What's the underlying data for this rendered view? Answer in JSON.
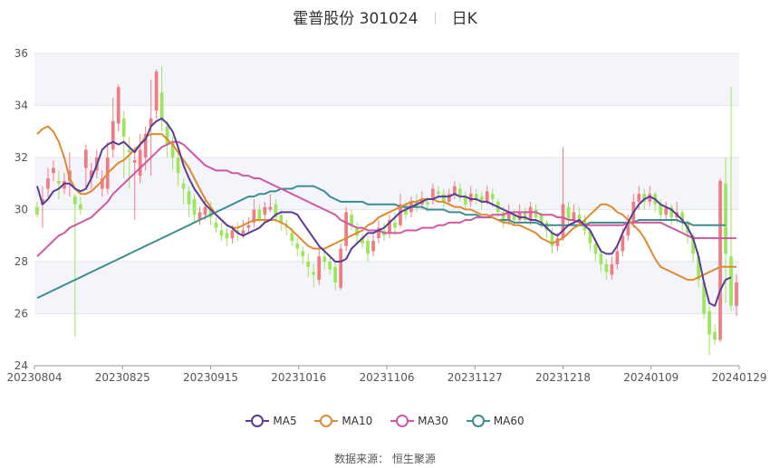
{
  "header": {
    "title": "霍普股份 301024",
    "period": "日K"
  },
  "source": {
    "label": "数据来源：",
    "name": "恒生聚源"
  },
  "colors": {
    "up": "#f07c82",
    "down": "#9be65a",
    "MA5": "#5a3b9a",
    "MA10": "#e08a30",
    "MA30": "#d257a2",
    "MA60": "#3a8e92"
  },
  "chart_data": {
    "type": "candlestick",
    "ylim": [
      24,
      36
    ],
    "yticks": [
      "24",
      "26",
      "28",
      "30",
      "32",
      "34",
      "36"
    ],
    "xticks": [
      "20230804",
      "20230825",
      "20230915",
      "20231016",
      "20231106",
      "20231127",
      "20231218",
      "20240109",
      "20240129"
    ],
    "grid": true,
    "legend_position": "bottom",
    "legend": [
      "MA5",
      "MA10",
      "MA30",
      "MA60"
    ],
    "candles": [
      [
        30.1,
        29.8,
        30.3,
        29.7
      ],
      [
        30.2,
        30.4,
        30.9,
        29.3
      ],
      [
        30.8,
        31.2,
        31.6,
        30.5
      ],
      [
        31.4,
        31.6,
        31.9,
        31.1
      ],
      [
        31.1,
        31.0,
        31.5,
        30.4
      ],
      [
        30.8,
        31.1,
        31.4,
        30.6
      ],
      [
        31.1,
        31.5,
        32.2,
        30.5
      ],
      [
        30.5,
        30.2,
        30.6,
        25.1
      ],
      [
        30.2,
        30.0,
        30.5,
        29.8
      ],
      [
        31.6,
        32.3,
        32.5,
        30.8
      ],
      [
        31.2,
        31.5,
        31.8,
        30.8
      ],
      [
        31.5,
        32.0,
        32.3,
        31.2
      ],
      [
        30.8,
        31.2,
        31.5,
        30.5
      ],
      [
        30.8,
        32.0,
        32.6,
        30.6
      ],
      [
        32.3,
        33.4,
        34.3,
        32.0
      ],
      [
        33.3,
        34.7,
        34.8,
        33.0
      ],
      [
        33.5,
        32.8,
        33.8,
        31.2
      ],
      [
        32.3,
        32.2,
        32.8,
        30.8
      ],
      [
        31.8,
        31.9,
        32.4,
        29.6
      ],
      [
        31.3,
        32.3,
        32.9,
        31.0
      ],
      [
        32.0,
        32.9,
        33.2,
        31.5
      ],
      [
        33.2,
        33.5,
        35.0,
        31.3
      ],
      [
        33.8,
        35.3,
        35.4,
        33.5
      ],
      [
        34.5,
        33.5,
        35.5,
        33.0
      ],
      [
        33.2,
        32.5,
        33.4,
        32.0
      ],
      [
        32.6,
        32.0,
        32.8,
        31.5
      ],
      [
        32.0,
        31.4,
        32.2,
        30.9
      ],
      [
        31.0,
        30.8,
        31.2,
        30.2
      ],
      [
        30.7,
        30.2,
        30.9,
        29.7
      ],
      [
        30.4,
        29.8,
        30.6,
        29.5
      ],
      [
        29.6,
        29.9,
        30.1,
        29.4
      ],
      [
        29.8,
        30.1,
        30.5,
        29.6
      ],
      [
        30.1,
        29.7,
        30.3,
        29.4
      ],
      [
        29.5,
        29.3,
        29.7,
        29.1
      ],
      [
        29.2,
        29.0,
        29.5,
        28.8
      ],
      [
        29.1,
        28.9,
        29.3,
        28.6
      ],
      [
        28.9,
        29.2,
        29.4,
        28.7
      ],
      [
        29.2,
        29.1,
        29.5,
        28.8
      ],
      [
        29.0,
        29.2,
        29.6,
        28.9
      ],
      [
        29.3,
        29.4,
        29.7,
        29.1
      ],
      [
        29.5,
        30.0,
        30.4,
        29.3
      ],
      [
        30.0,
        29.6,
        30.2,
        29.5
      ],
      [
        29.8,
        30.1,
        30.3,
        29.5
      ],
      [
        30.0,
        30.1,
        30.6,
        29.9
      ],
      [
        30.2,
        29.7,
        30.4,
        29.5
      ],
      [
        29.8,
        29.5,
        30.0,
        29.2
      ],
      [
        29.4,
        29.3,
        29.6,
        29.0
      ],
      [
        29.1,
        28.8,
        29.3,
        28.6
      ],
      [
        28.7,
        28.5,
        28.9,
        28.2
      ],
      [
        28.4,
        28.2,
        28.6,
        27.9
      ],
      [
        28.0,
        27.8,
        28.3,
        27.4
      ],
      [
        27.6,
        27.5,
        27.9,
        27.0
      ],
      [
        27.3,
        28.2,
        28.6,
        27.1
      ],
      [
        28.2,
        28.0,
        28.5,
        27.7
      ],
      [
        28.0,
        27.7,
        28.3,
        27.5
      ],
      [
        27.8,
        27.2,
        28.0,
        26.9
      ],
      [
        27.0,
        28.5,
        28.7,
        26.9
      ],
      [
        28.6,
        29.9,
        30.1,
        28.4
      ],
      [
        29.8,
        29.4,
        30.0,
        29.2
      ],
      [
        29.3,
        29.0,
        29.5,
        28.7
      ],
      [
        28.9,
        28.7,
        29.1,
        28.5
      ],
      [
        28.8,
        28.3,
        29.0,
        28.0
      ],
      [
        28.4,
        28.8,
        29.1,
        28.2
      ],
      [
        28.9,
        29.3,
        29.6,
        28.7
      ],
      [
        29.2,
        29.0,
        29.5,
        28.8
      ],
      [
        29.1,
        29.6,
        29.8,
        28.9
      ],
      [
        29.5,
        29.3,
        29.9,
        29.0
      ],
      [
        29.4,
        30.2,
        30.6,
        29.3
      ],
      [
        30.1,
        29.8,
        30.3,
        29.6
      ],
      [
        29.9,
        30.3,
        30.5,
        29.7
      ],
      [
        30.3,
        30.1,
        30.6,
        29.9
      ],
      [
        30.2,
        30.4,
        30.7,
        30.0
      ],
      [
        30.3,
        30.2,
        30.5,
        29.9
      ],
      [
        30.4,
        30.8,
        31.0,
        30.2
      ],
      [
        30.7,
        30.6,
        30.9,
        30.4
      ],
      [
        30.6,
        30.3,
        30.8,
        30.1
      ],
      [
        30.3,
        30.6,
        30.8,
        30.2
      ],
      [
        30.6,
        30.9,
        31.1,
        30.4
      ],
      [
        30.8,
        30.5,
        31.0,
        30.3
      ],
      [
        30.5,
        30.2,
        30.7,
        30.0
      ],
      [
        30.3,
        30.6,
        30.9,
        30.1
      ],
      [
        30.6,
        30.4,
        30.8,
        30.2
      ],
      [
        30.5,
        30.3,
        30.7,
        30.0
      ],
      [
        30.3,
        30.7,
        30.9,
        30.2
      ],
      [
        30.6,
        30.4,
        30.8,
        30.1
      ],
      [
        30.3,
        29.9,
        30.4,
        29.7
      ],
      [
        29.9,
        29.5,
        30.1,
        29.3
      ],
      [
        29.6,
        29.9,
        30.2,
        29.4
      ],
      [
        29.8,
        29.6,
        30.0,
        29.4
      ],
      [
        29.6,
        29.9,
        30.2,
        29.5
      ],
      [
        29.9,
        29.6,
        30.1,
        29.5
      ],
      [
        29.6,
        30.1,
        30.3,
        29.4
      ],
      [
        30.0,
        29.7,
        30.2,
        29.5
      ],
      [
        29.8,
        29.5,
        29.9,
        29.3
      ],
      [
        29.5,
        29.2,
        29.6,
        28.9
      ],
      [
        29.1,
        28.6,
        29.3,
        28.3
      ],
      [
        28.6,
        28.9,
        29.1,
        28.4
      ],
      [
        28.9,
        30.2,
        32.4,
        28.8
      ],
      [
        30.1,
        29.6,
        30.3,
        29.4
      ],
      [
        29.6,
        29.9,
        30.2,
        29.4
      ],
      [
        29.8,
        29.6,
        30.1,
        29.4
      ],
      [
        29.6,
        29.2,
        29.8,
        29.0
      ],
      [
        29.2,
        28.7,
        29.3,
        28.4
      ],
      [
        28.7,
        28.3,
        28.9,
        28.0
      ],
      [
        28.3,
        27.9,
        28.5,
        27.6
      ],
      [
        27.9,
        27.6,
        28.1,
        27.3
      ],
      [
        27.5,
        27.9,
        28.2,
        27.3
      ],
      [
        27.9,
        28.4,
        28.7,
        27.7
      ],
      [
        28.4,
        29.0,
        29.3,
        28.2
      ],
      [
        29.0,
        29.5,
        29.8,
        28.8
      ],
      [
        29.5,
        30.3,
        30.6,
        29.3
      ],
      [
        30.3,
        30.6,
        30.9,
        30.0
      ],
      [
        30.6,
        30.3,
        30.8,
        30.0
      ],
      [
        30.3,
        30.6,
        30.9,
        30.1
      ],
      [
        30.6,
        30.2,
        30.7,
        29.9
      ],
      [
        30.2,
        29.8,
        30.4,
        29.5
      ],
      [
        29.8,
        30.1,
        30.3,
        29.6
      ],
      [
        30.1,
        29.7,
        30.2,
        29.4
      ],
      [
        29.7,
        29.9,
        30.3,
        29.5
      ],
      [
        29.9,
        29.5,
        30.0,
        29.2
      ],
      [
        29.5,
        29.1,
        29.6,
        28.7
      ],
      [
        29.0,
        28.3,
        29.1,
        28.0
      ],
      [
        28.2,
        27.3,
        28.4,
        27.0
      ],
      [
        27.2,
        26.0,
        27.3,
        25.8
      ],
      [
        26.1,
        25.2,
        26.3,
        24.4
      ],
      [
        25.3,
        25.0,
        25.6,
        24.8
      ],
      [
        25.0,
        31.1,
        31.2,
        24.9
      ],
      [
        31.0,
        28.3,
        32.0,
        26.4
      ],
      [
        28.2,
        26.3,
        34.7,
        26.1
      ],
      [
        26.3,
        27.2,
        27.5,
        25.9
      ]
    ],
    "ma": {
      "MA5": [
        30.9,
        30.2,
        30.4,
        30.7,
        30.8,
        31.0,
        31.0,
        30.8,
        30.7,
        30.8,
        31.2,
        31.7,
        32.3,
        32.5,
        32.6,
        32.5,
        32.6,
        32.4,
        32.2,
        32.5,
        32.7,
        33.2,
        33.4,
        33.5,
        33.3,
        33.0,
        32.4,
        31.7,
        31.2,
        30.8,
        30.5,
        30.2,
        30.0,
        29.8,
        29.6,
        29.4,
        29.3,
        29.1,
        29.0,
        29.1,
        29.2,
        29.3,
        29.5,
        29.6,
        29.8,
        29.9,
        29.9,
        29.9,
        29.8,
        29.5,
        29.2,
        28.9,
        28.6,
        28.4,
        28.2,
        28.0,
        28.0,
        28.1,
        28.5,
        28.7,
        28.9,
        29.1,
        29.1,
        29.2,
        29.3,
        29.5,
        29.7,
        29.9,
        30.0,
        30.1,
        30.2,
        30.3,
        30.4,
        30.4,
        30.5,
        30.5,
        30.5,
        30.6,
        30.5,
        30.5,
        30.4,
        30.4,
        30.3,
        30.3,
        30.2,
        30.1,
        30.0,
        29.9,
        29.8,
        29.7,
        29.7,
        29.6,
        29.6,
        29.5,
        29.3,
        29.1,
        29.0,
        29.2,
        29.4,
        29.5,
        29.6,
        29.4,
        29.2,
        28.8,
        28.4,
        28.3,
        28.3,
        28.6,
        29.1,
        29.5,
        29.9,
        30.2,
        30.4,
        30.5,
        30.4,
        30.2,
        30.1,
        30.0,
        29.8,
        29.6,
        29.3,
        28.9,
        28.2,
        27.2,
        26.4,
        26.3,
        26.9,
        27.3,
        27.4
      ],
      "MA10": [
        32.9,
        33.1,
        33.2,
        33.0,
        32.6,
        32.0,
        31.2,
        30.8,
        30.6,
        30.6,
        30.7,
        30.9,
        31.1,
        31.4,
        31.6,
        31.8,
        31.9,
        32.1,
        32.3,
        32.5,
        32.8,
        32.9,
        32.9,
        32.9,
        32.7,
        32.5,
        32.2,
        31.9,
        31.6,
        31.2,
        30.8,
        30.4,
        30.1,
        29.8,
        29.6,
        29.4,
        29.3,
        29.3,
        29.4,
        29.5,
        29.6,
        29.6,
        29.6,
        29.6,
        29.6,
        29.5,
        29.4,
        29.2,
        29.0,
        28.8,
        28.6,
        28.5,
        28.5,
        28.5,
        28.6,
        28.7,
        28.8,
        28.9,
        29.0,
        29.1,
        29.2,
        29.4,
        29.5,
        29.7,
        29.8,
        29.9,
        30.0,
        30.1,
        30.2,
        30.3,
        30.3,
        30.4,
        30.4,
        30.4,
        30.3,
        30.3,
        30.2,
        30.1,
        30.1,
        30.0,
        30.0,
        29.9,
        29.8,
        29.8,
        29.7,
        29.6,
        29.5,
        29.5,
        29.4,
        29.4,
        29.3,
        29.2,
        29.1,
        28.9,
        28.8,
        28.7,
        28.8,
        28.9,
        29.1,
        29.3,
        29.4,
        29.6,
        29.8,
        30.0,
        30.2,
        30.2,
        30.1,
        29.9,
        29.8,
        29.6,
        29.4,
        29.2,
        28.9,
        28.5,
        28.1,
        27.8,
        27.7,
        27.6,
        27.5,
        27.4,
        27.3,
        27.3,
        27.4,
        27.5,
        27.6,
        27.7,
        27.8,
        27.8,
        27.8,
        27.8
      ],
      "MA30": [
        28.2,
        28.4,
        28.6,
        28.8,
        29.0,
        29.1,
        29.3,
        29.4,
        29.5,
        29.6,
        29.7,
        29.9,
        30.1,
        30.3,
        30.6,
        30.8,
        31.0,
        31.2,
        31.4,
        31.6,
        31.8,
        32.0,
        32.2,
        32.4,
        32.5,
        32.6,
        32.6,
        32.5,
        32.3,
        32.1,
        31.9,
        31.7,
        31.6,
        31.5,
        31.5,
        31.5,
        31.4,
        31.4,
        31.3,
        31.3,
        31.2,
        31.2,
        31.1,
        31.0,
        30.9,
        30.8,
        30.7,
        30.6,
        30.5,
        30.4,
        30.3,
        30.2,
        30.1,
        30.0,
        29.9,
        29.8,
        29.6,
        29.5,
        29.4,
        29.3,
        29.3,
        29.2,
        29.2,
        29.2,
        29.1,
        29.1,
        29.1,
        29.1,
        29.2,
        29.2,
        29.2,
        29.3,
        29.3,
        29.3,
        29.4,
        29.4,
        29.5,
        29.5,
        29.5,
        29.6,
        29.6,
        29.7,
        29.7,
        29.7,
        29.8,
        29.8,
        29.8,
        29.9,
        29.9,
        29.9,
        29.9,
        29.9,
        29.9,
        29.8,
        29.8,
        29.8,
        29.7,
        29.7,
        29.6,
        29.6,
        29.5,
        29.4,
        29.4,
        29.4,
        29.4,
        29.4,
        29.4,
        29.4,
        29.4,
        29.5,
        29.5,
        29.5,
        29.5,
        29.5,
        29.5,
        29.5,
        29.4,
        29.3,
        29.2,
        29.1,
        29.0,
        28.9,
        28.9,
        28.9,
        28.9,
        28.9,
        28.9,
        28.9,
        28.9,
        28.9
      ],
      "MA60": [
        26.6,
        26.7,
        26.8,
        26.9,
        27.0,
        27.1,
        27.2,
        27.3,
        27.4,
        27.5,
        27.6,
        27.7,
        27.8,
        27.9,
        28.0,
        28.1,
        28.2,
        28.3,
        28.4,
        28.5,
        28.6,
        28.7,
        28.8,
        28.9,
        29.0,
        29.1,
        29.2,
        29.3,
        29.4,
        29.5,
        29.6,
        29.7,
        29.8,
        29.9,
        30.0,
        30.1,
        30.2,
        30.3,
        30.4,
        30.5,
        30.5,
        30.6,
        30.6,
        30.7,
        30.7,
        30.8,
        30.8,
        30.8,
        30.9,
        30.9,
        30.9,
        30.9,
        30.8,
        30.7,
        30.5,
        30.4,
        30.3,
        30.3,
        30.3,
        30.3,
        30.3,
        30.2,
        30.2,
        30.2,
        30.2,
        30.2,
        30.2,
        30.1,
        30.1,
        30.1,
        30.1,
        30.1,
        30.0,
        30.0,
        30.0,
        30.0,
        29.9,
        29.9,
        29.9,
        29.8,
        29.8,
        29.8,
        29.7,
        29.7,
        29.7,
        29.6,
        29.6,
        29.6,
        29.5,
        29.5,
        29.5,
        29.5,
        29.5,
        29.4,
        29.4,
        29.4,
        29.4,
        29.4,
        29.4,
        29.4,
        29.4,
        29.4,
        29.5,
        29.5,
        29.5,
        29.5,
        29.5,
        29.5,
        29.5,
        29.5,
        29.5,
        29.6,
        29.6,
        29.6,
        29.6,
        29.6,
        29.6,
        29.6,
        29.6,
        29.5,
        29.5,
        29.4,
        29.4,
        29.4,
        29.4,
        29.4,
        29.4,
        29.4
      ]
    }
  }
}
